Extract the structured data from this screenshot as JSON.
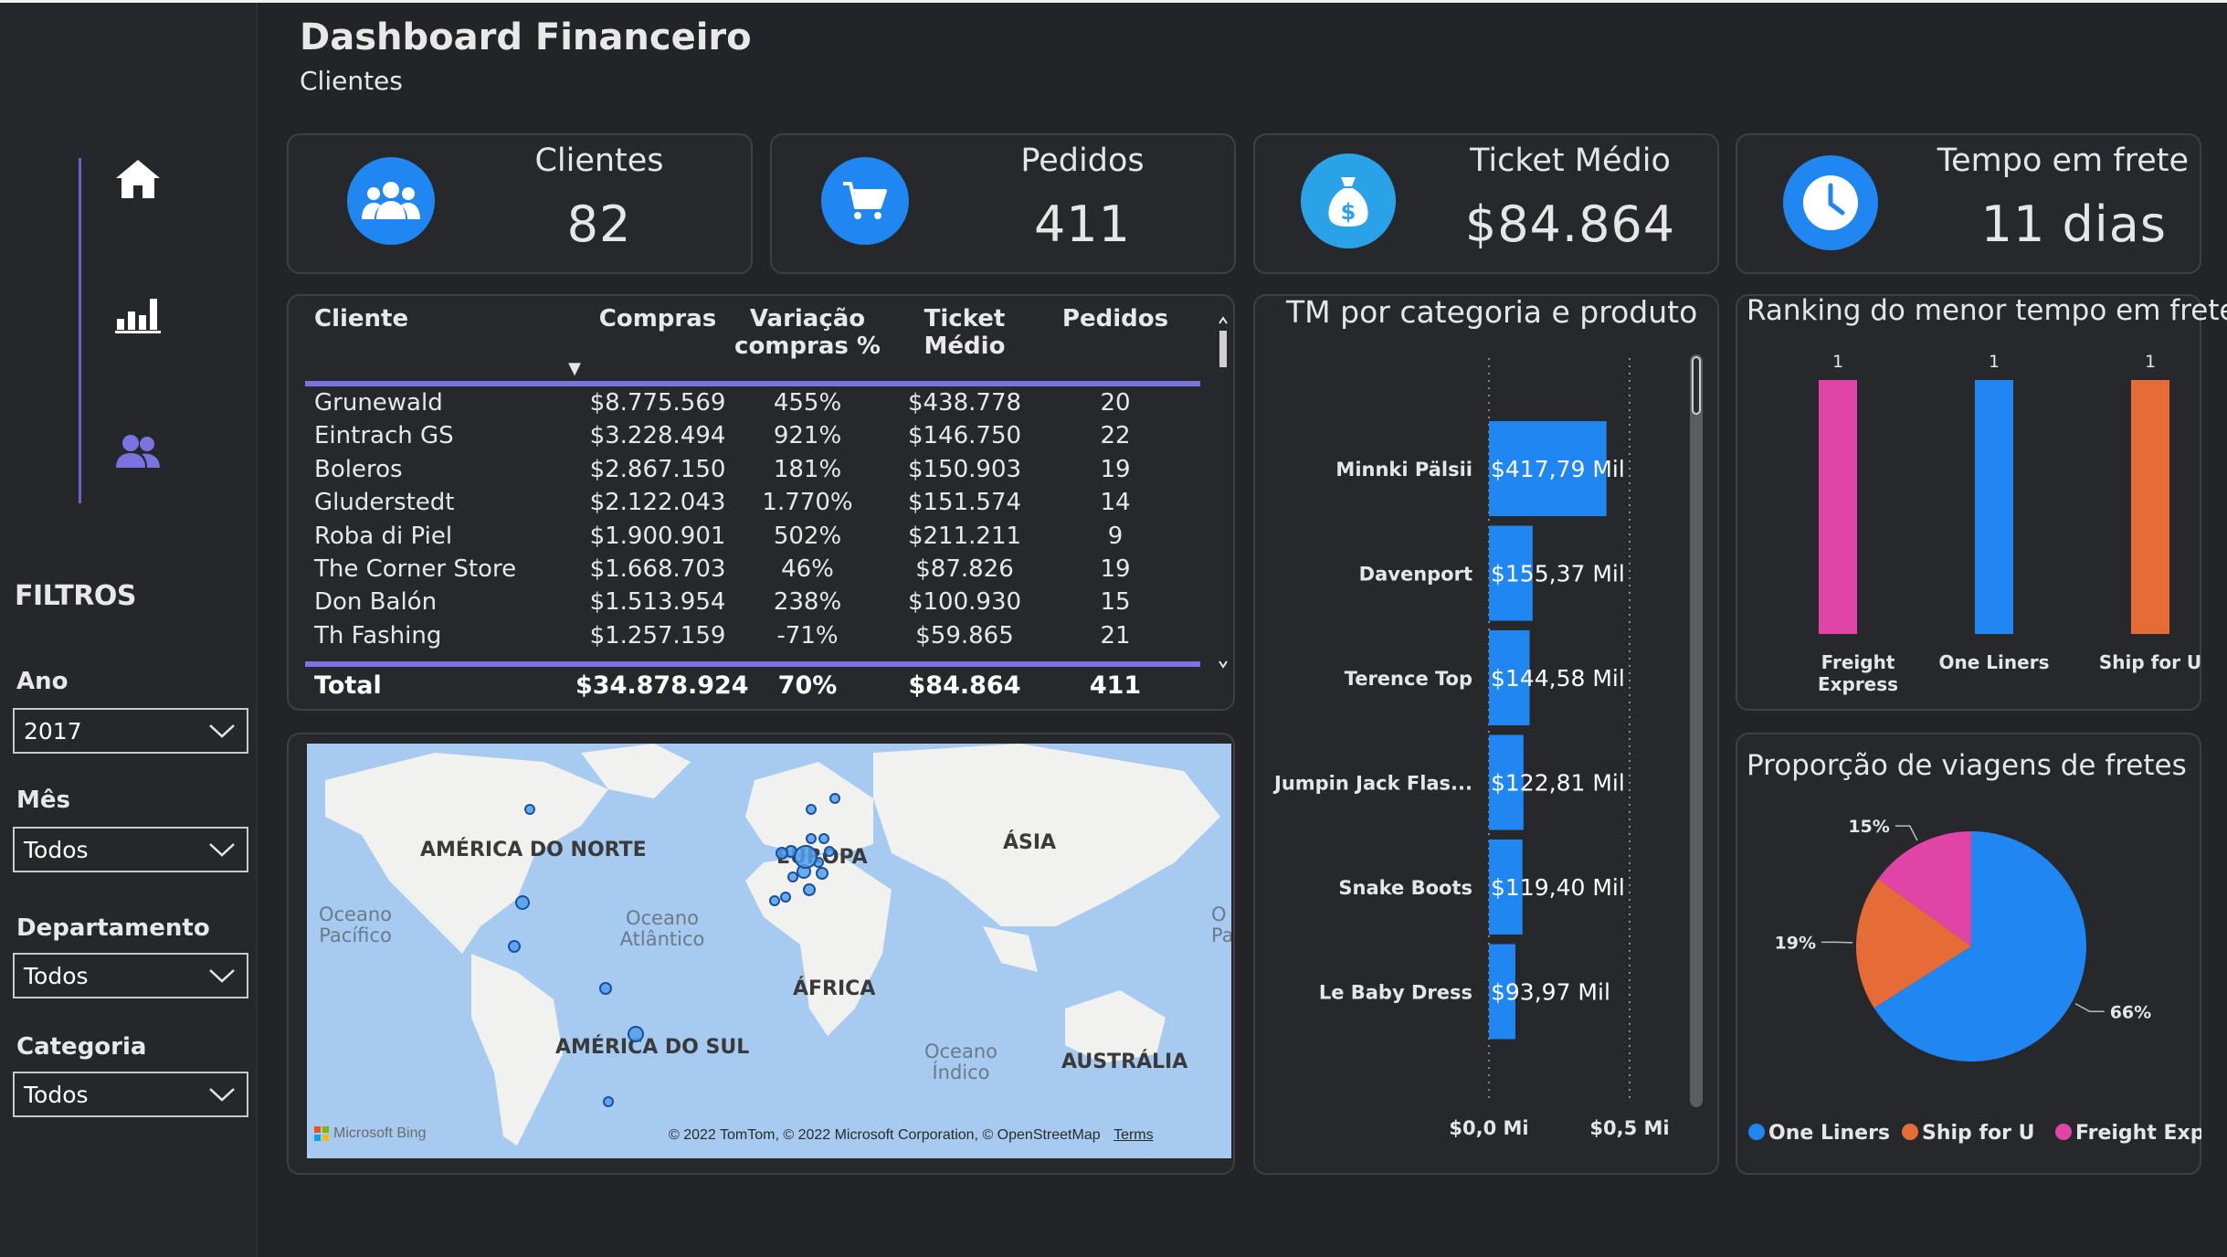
{
  "header": {
    "title": "Dashboard Financeiro",
    "subtitle": "Clientes"
  },
  "nav": [
    {
      "icon": "home-icon"
    },
    {
      "icon": "bar-chart-icon"
    },
    {
      "icon": "users-icon",
      "active": true
    }
  ],
  "filters": {
    "title": "FILTROS",
    "items": [
      {
        "label": "Ano",
        "value": "2017"
      },
      {
        "label": "Mês",
        "value": "Todos"
      },
      {
        "label": "Departamento",
        "value": "Todos"
      },
      {
        "label": "Categoria",
        "value": "Todos"
      }
    ]
  },
  "kpis": [
    {
      "label": "Clientes",
      "value": "82",
      "icon": "users-icon"
    },
    {
      "label": "Pedidos",
      "value": "411",
      "icon": "cart-icon"
    },
    {
      "label": "Ticket Médio",
      "value": "$84.864",
      "icon": "money-bag-icon"
    },
    {
      "label": "Tempo em frete",
      "value": "11 dias",
      "icon": "clock-icon"
    }
  ],
  "table": {
    "headers": [
      "Cliente",
      "Compras",
      "Variação compras %",
      "Ticket Médio",
      "Pedidos"
    ],
    "sort_indicator": "▼",
    "rows": [
      [
        "Grunewald",
        "$8.775.569",
        "455%",
        "$438.778",
        "20"
      ],
      [
        "Eintrach GS",
        "$3.228.494",
        "921%",
        "$146.750",
        "22"
      ],
      [
        "Boleros",
        "$2.867.150",
        "181%",
        "$150.903",
        "19"
      ],
      [
        "Gluderstedt",
        "$2.122.043",
        "1.770%",
        "$151.574",
        "14"
      ],
      [
        "Roba di Piel",
        "$1.900.901",
        "502%",
        "$211.211",
        "9"
      ],
      [
        "The Corner Store",
        "$1.668.703",
        "46%",
        "$87.826",
        "19"
      ],
      [
        "Don Balón",
        "$1.513.954",
        "238%",
        "$100.930",
        "15"
      ],
      [
        "Th Fashing",
        "$1.257.159",
        "-71%",
        "$59.865",
        "21"
      ]
    ],
    "total": [
      "Total",
      "$34.878.924",
      "70%",
      "$84.864",
      "411"
    ]
  },
  "map": {
    "labels": {
      "north_america": "AMÉRICA DO NORTE",
      "europe": "EUROPA",
      "asia": "ÁSIA",
      "africa": "ÁFRICA",
      "south_america": "AMÉRICA DO SUL",
      "australia": "AUSTRÁLIA",
      "pacific": "Oceano Pacífico",
      "atlantic": "Oceano Atlântico",
      "indian": "Oceano Índico",
      "pacific_right": "O Pa"
    },
    "attribution_brand": "Microsoft Bing",
    "attribution": "© 2022 TomTom, © 2022 Microsoft Corporation, © OpenStreetMap",
    "terms": "Terms"
  },
  "bar_chart": {
    "title": "TM por categoria e produto",
    "xaxis_ticks": [
      "$0,0 Mi",
      "$0,5 Mi"
    ],
    "color": "#1f86f2"
  },
  "column_chart": {
    "title": "Ranking do menor tempo em frete"
  },
  "pie_chart": {
    "title": "Proporção de viagens de fretes"
  },
  "chart_data": [
    {
      "type": "bar",
      "title": "TM por categoria e produto",
      "categories": [
        "Minnki Pälsii",
        "Davenport",
        "Terence Top",
        "Jumpin Jack Flas...",
        "Snake Boots",
        "Le Baby Dress"
      ],
      "values": [
        417.79,
        155.37,
        144.58,
        122.81,
        119.4,
        93.97
      ],
      "data_labels": [
        "$417,79 Mil",
        "$155,37 Mil",
        "$144,58 Mil",
        "$122,81 Mil",
        "$119,40 Mil",
        "$93,97 Mil"
      ],
      "unit": "Mil",
      "xlim": [
        0,
        500
      ],
      "xticks": [
        "$0,0 Mi",
        "$0,5 Mi"
      ],
      "grid": true
    },
    {
      "type": "bar",
      "title": "Ranking do menor tempo em frete",
      "categories": [
        "Freight Express",
        "One Liners",
        "Ship for U"
      ],
      "values": [
        1,
        1,
        1
      ],
      "colors": [
        "#e044a7",
        "#1f86f2",
        "#e66c37"
      ]
    },
    {
      "type": "pie",
      "title": "Proporção de viagens de fretes",
      "slices": [
        {
          "label": "One Liners",
          "value": 66,
          "color": "#1f86f2",
          "text": "66%"
        },
        {
          "label": "Ship for U",
          "value": 19,
          "color": "#e66c37",
          "text": "19%"
        },
        {
          "label": "Freight Express",
          "value": 15,
          "color": "#e044a7",
          "text": "15%"
        }
      ],
      "legend": [
        "One Liners",
        "Ship for U",
        "Freight Express"
      ],
      "legend_position": "bottom"
    }
  ]
}
